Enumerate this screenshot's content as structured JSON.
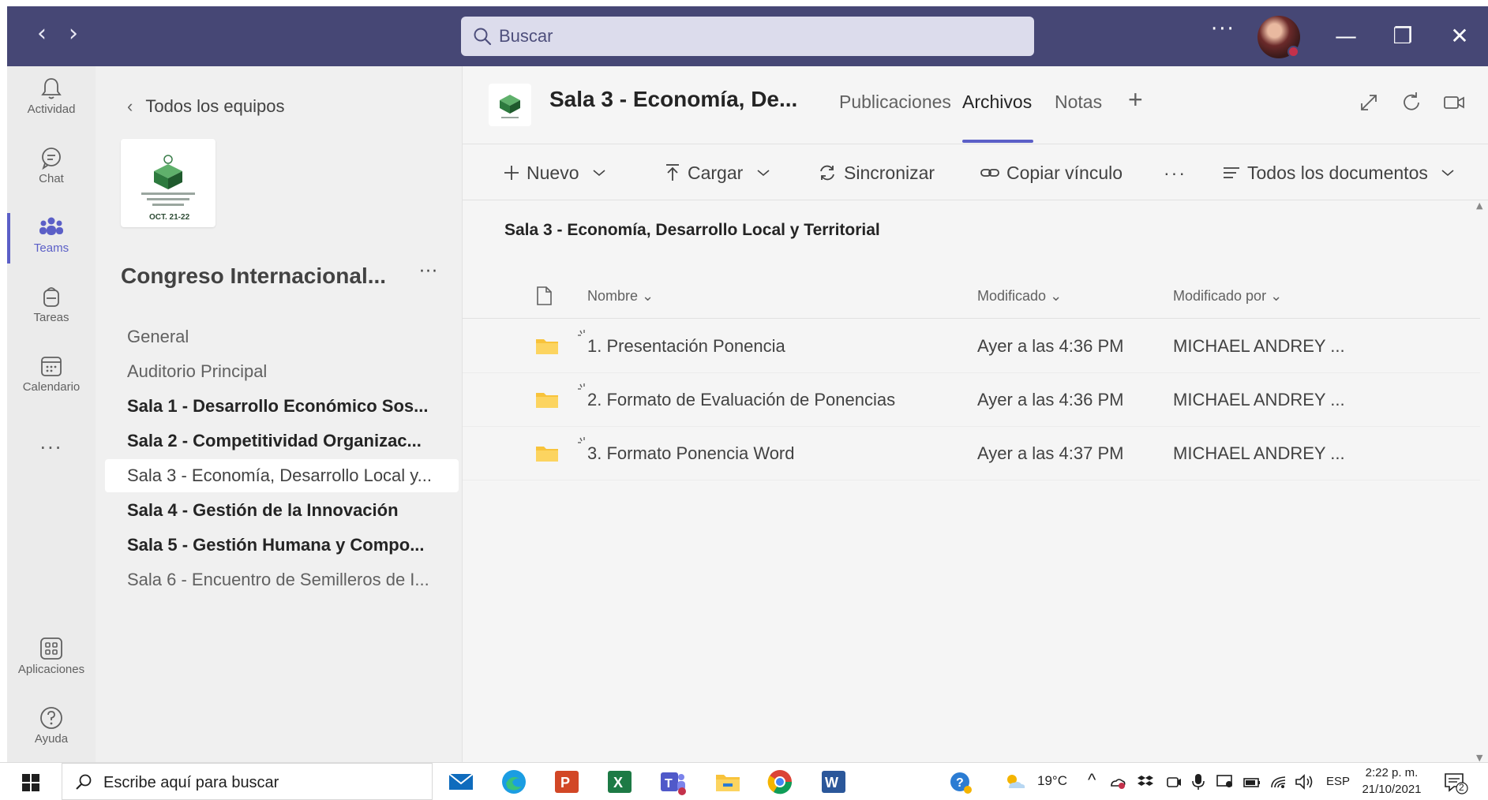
{
  "titlebar": {
    "back_glyph": "‹",
    "forward_glyph": "›",
    "search_placeholder": "Buscar",
    "more_glyph": "···",
    "minimize_glyph": "—",
    "restore_glyph": "❐",
    "close_glyph": "✕"
  },
  "rail": {
    "items": [
      {
        "label": "Actividad",
        "icon": "bell-icon"
      },
      {
        "label": "Chat",
        "icon": "chat-icon"
      },
      {
        "label": "Teams",
        "icon": "teams-icon"
      },
      {
        "label": "Tareas",
        "icon": "tasks-icon"
      },
      {
        "label": "Calendario",
        "icon": "calendar-icon"
      }
    ],
    "more_glyph": "···",
    "bottom_items": [
      {
        "label": "Aplicaciones",
        "icon": "apps-icon"
      },
      {
        "label": "Ayuda",
        "icon": "help-icon"
      }
    ]
  },
  "team_panel": {
    "back_label": "Todos los equipos",
    "logo_date": "OCT. 21-22",
    "team_name": "Congreso Internacional...",
    "more_glyph": "···",
    "channels": [
      {
        "label": "General",
        "style": "normal"
      },
      {
        "label": "Auditorio Principal",
        "style": "normal"
      },
      {
        "label": "Sala 1 - Desarrollo Económico Sos...",
        "style": "bold"
      },
      {
        "label": "Sala 2 - Competitividad Organizac...",
        "style": "bold"
      },
      {
        "label": "Sala 3 - Economía, Desarrollo Local y...",
        "style": "selected"
      },
      {
        "label": "Sala 4 - Gestión de la Innovación",
        "style": "bold"
      },
      {
        "label": "Sala 5 - Gestión Humana y Compo...",
        "style": "bold"
      },
      {
        "label": "Sala 6 - Encuentro de Semilleros de I...",
        "style": "normal"
      }
    ]
  },
  "main": {
    "channel_title": "Sala 3 - Economía, De...",
    "tabs": [
      {
        "label": "Publicaciones",
        "active": false
      },
      {
        "label": "Archivos",
        "active": true
      },
      {
        "label": "Notas",
        "active": false
      }
    ],
    "add_tab_glyph": "+",
    "toolbar": {
      "new_label": "Nuevo",
      "upload_label": "Cargar",
      "sync_label": "Sincronizar",
      "copy_link_label": "Copiar vínculo",
      "more_glyph": "···",
      "view_label": "Todos los documentos"
    },
    "breadcrumb": "Sala 3 - Economía, Desarrollo Local y Territorial",
    "columns": {
      "name": "Nombre",
      "modified": "Modificado",
      "modified_by": "Modificado por"
    },
    "rows": [
      {
        "name": "1. Presentación Ponencia",
        "modified": "Ayer a las 4:36 PM",
        "modified_by": "MICHAEL ANDREY ..."
      },
      {
        "name": "2. Formato de Evaluación de Ponencias",
        "modified": "Ayer a las 4:36 PM",
        "modified_by": "MICHAEL ANDREY ..."
      },
      {
        "name": "3. Formato Ponencia Word",
        "modified": "Ayer a las 4:37 PM",
        "modified_by": "MICHAEL ANDREY ..."
      }
    ]
  },
  "taskbar": {
    "search_placeholder": "Escribe aquí para buscar",
    "temperature": "19°C",
    "language": "ESP",
    "time": "2:22 p. m.",
    "date": "21/10/2021",
    "notification_count": "2"
  },
  "colors": {
    "titlebar": "#464775",
    "accent": "#5b5fc7",
    "folder": "#f8c33b"
  }
}
